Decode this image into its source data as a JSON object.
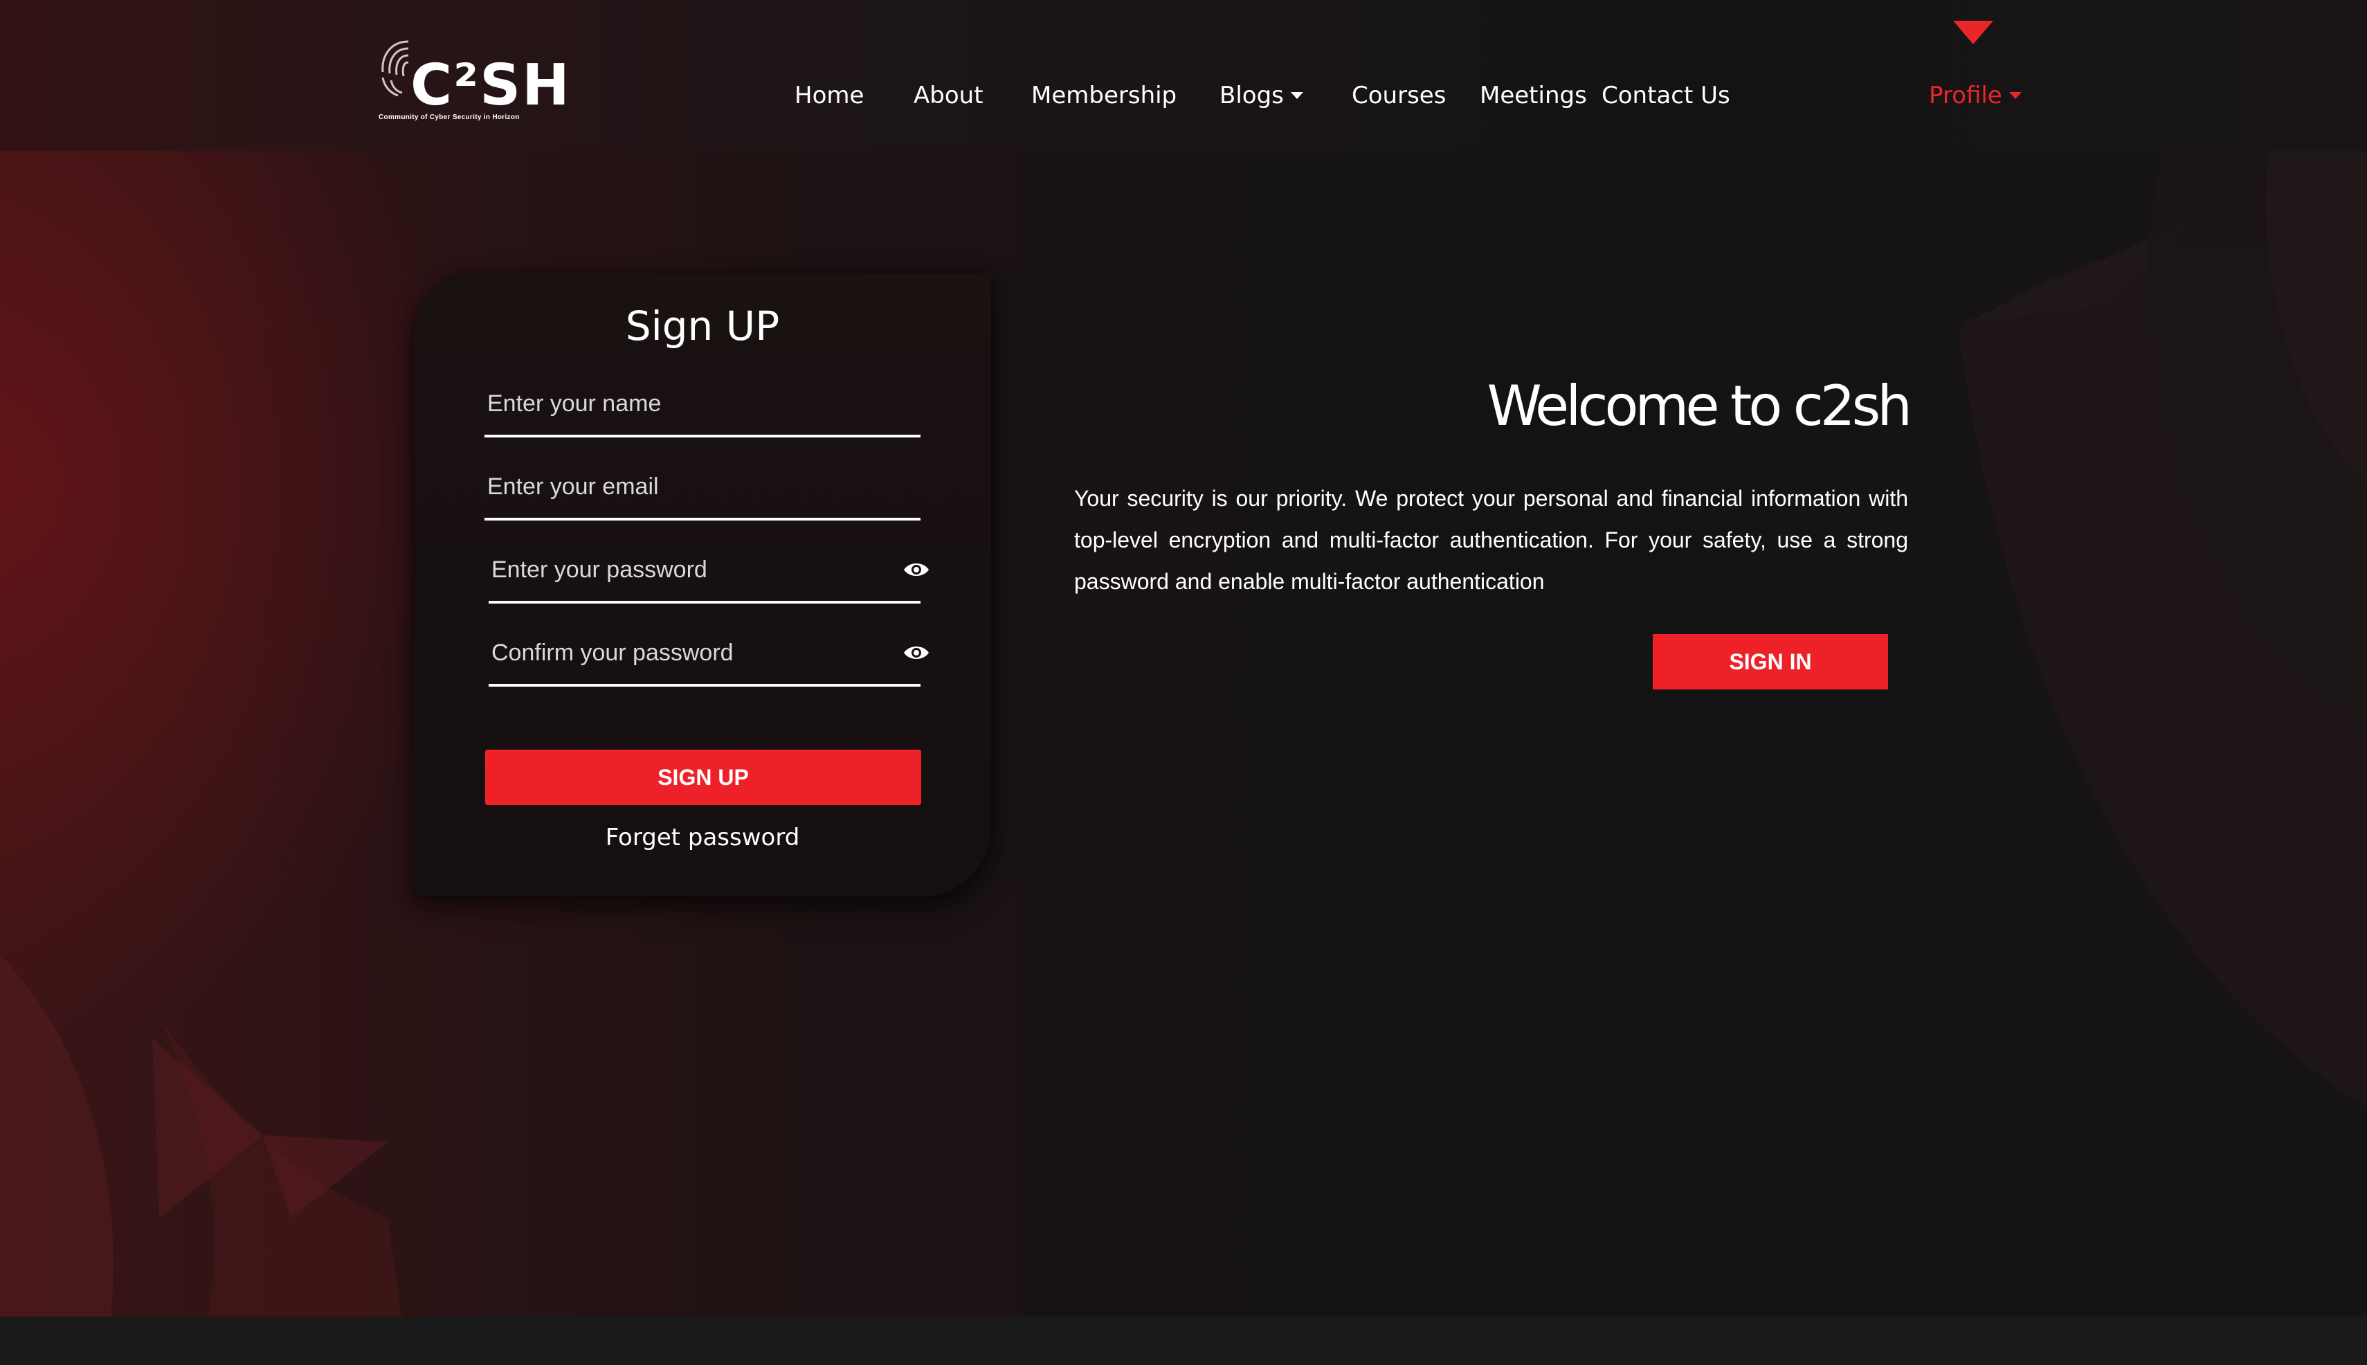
{
  "header": {
    "logo": {
      "text": "C²SH",
      "tagline": "Community of Cyber Security in Horizon"
    },
    "nav": [
      {
        "label": "Home"
      },
      {
        "label": "About"
      },
      {
        "label": "Membership"
      },
      {
        "label": "Blogs",
        "dropdown": true
      },
      {
        "label": "Courses"
      },
      {
        "label": "Meetings"
      },
      {
        "label": "Contact Us"
      }
    ],
    "profile": {
      "label": "Profile",
      "dropdown": true
    }
  },
  "signup": {
    "title": "Sign UP",
    "fields": {
      "name": {
        "placeholder": "Enter your name",
        "value": ""
      },
      "email": {
        "placeholder": "Enter your email",
        "value": ""
      },
      "password": {
        "placeholder": "Enter your password",
        "value": "",
        "icon": "eye-icon"
      },
      "confirm": {
        "placeholder": "Confirm your password",
        "value": "",
        "icon": "eye-icon"
      }
    },
    "submit_label": "SIGN UP",
    "forget_label": "Forget password"
  },
  "welcome": {
    "title": "Welcome to c2sh",
    "text": "Your security is our priority. We protect your personal and financial information with top-level encryption and multi-factor authentication. For your safety, use a strong password and enable multi-factor authentication",
    "signin_label": "SIGN IN"
  },
  "colors": {
    "accent": "#ee2128",
    "background": "#131314",
    "card": "#170f10",
    "text": "#ffffff"
  }
}
